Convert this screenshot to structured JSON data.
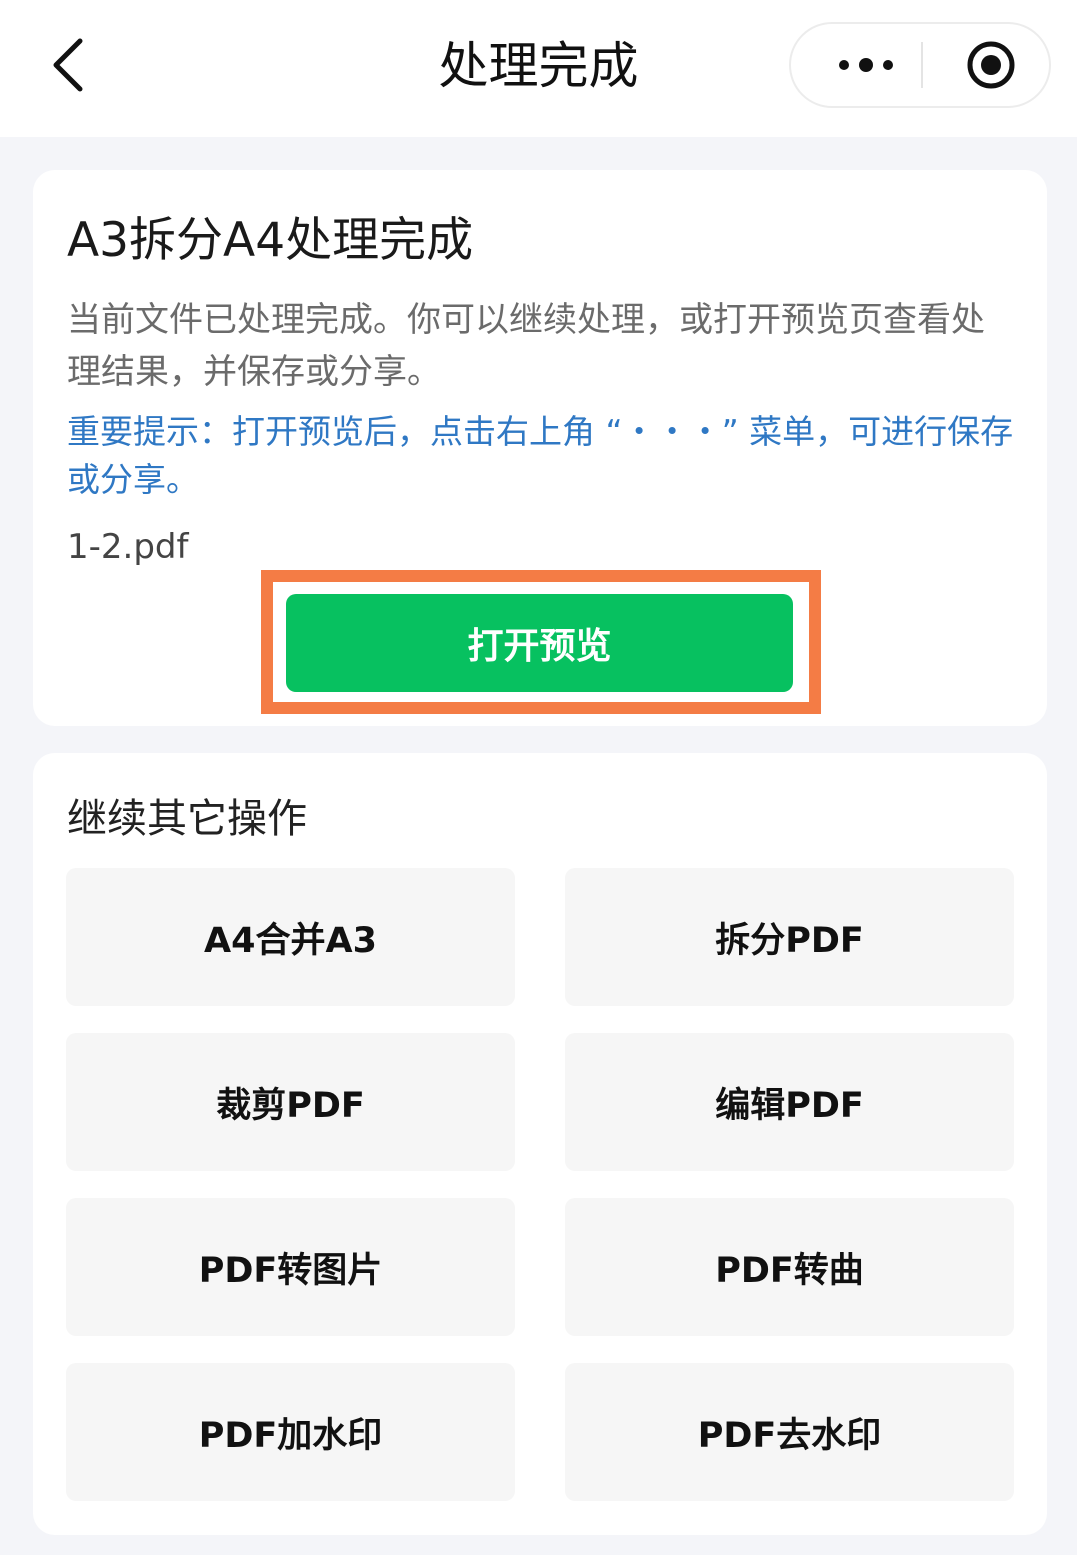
{
  "navbar": {
    "title": "处理完成",
    "back_icon": "chevron-left-icon",
    "more_icon": "more-dots-icon",
    "close_icon": "record-circle-icon"
  },
  "result_card": {
    "title": "A3拆分A4处理完成",
    "description": "当前文件已处理完成。你可以继续处理，或打开预览页查看处理结果，并保存或分享。",
    "tip": "重要提示：打开预览后，点击右上角 “・・・” 菜单，可进行保存或分享。",
    "filename": "1-2.pdf",
    "open_preview_label": "打开预览",
    "highlight_color": "#f47c45",
    "button_color": "#07c160"
  },
  "other_ops": {
    "title": "继续其它操作",
    "items": [
      {
        "label": "A4合并A3"
      },
      {
        "label": "拆分PDF"
      },
      {
        "label": "裁剪PDF"
      },
      {
        "label": "编辑PDF"
      },
      {
        "label": "PDF转图片"
      },
      {
        "label": "PDF转曲"
      },
      {
        "label": "PDF加水印"
      },
      {
        "label": "PDF去水印"
      }
    ]
  }
}
